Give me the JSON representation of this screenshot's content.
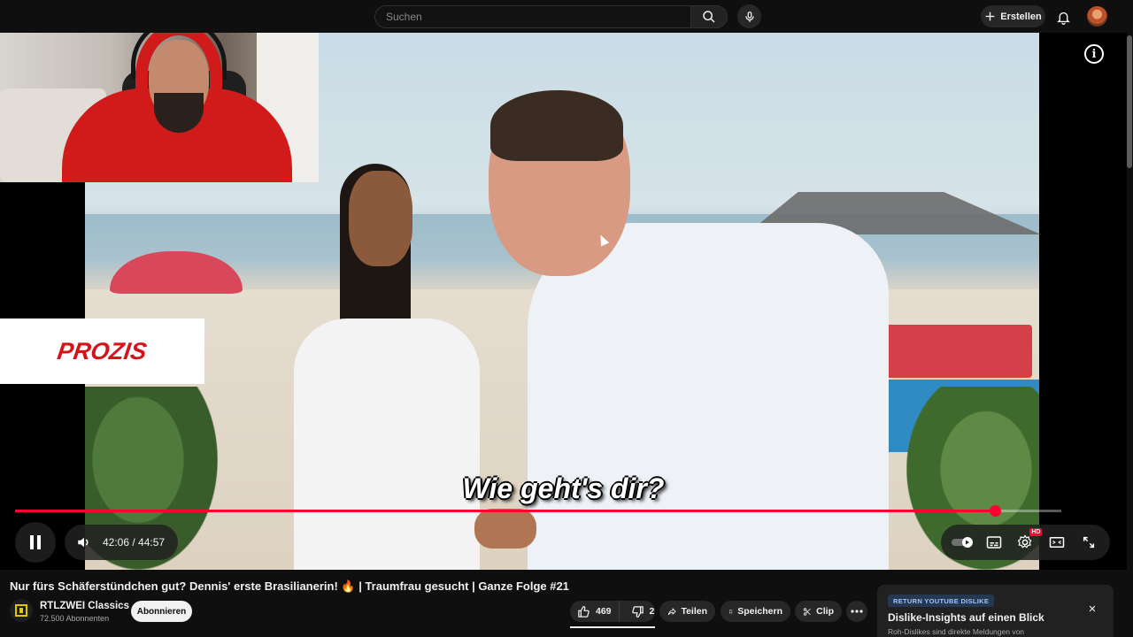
{
  "masthead": {
    "search_placeholder": "Suchen",
    "create_label": "Erstellen",
    "icons": [
      "search-icon",
      "mic-icon",
      "plus-icon",
      "bell-icon"
    ]
  },
  "player": {
    "subtitle": "Wie geht's dir?",
    "sponsor_text": "PROZIS",
    "current_time": "42:06",
    "duration": "44:57",
    "time_display": "42:06 / 44:57",
    "progress": 0.9366,
    "quality_badge": "HD",
    "accent_color": "#ff0033",
    "icons": [
      "info-icon",
      "pause-icon",
      "volume-icon",
      "autoplay-icon",
      "subtitles-icon",
      "settings-icon",
      "theater-icon",
      "fullscreen-icon"
    ]
  },
  "video": {
    "title": "Nur fürs Schäferstündchen gut? Dennis' erste Brasilianerin! 🔥 | Traumfrau gesucht | Ganze Folge #21"
  },
  "channel": {
    "name": "RTLZWEI Classics",
    "subscribers": "72.500 Abonnenten",
    "subscribe_label": "Abonnieren"
  },
  "actions": {
    "like_count": "469",
    "dislike_count": "2",
    "share_label": "Teilen",
    "save_label": "Speichern",
    "clip_label": "Clip"
  },
  "return_dislike": {
    "badge": "RETURN YOUTUBE DISLIKE",
    "title": "Dislike-Insights auf einen Blick",
    "description": "Roh-Dislikes sind direkte Meldungen von",
    "close_label": "✕"
  }
}
